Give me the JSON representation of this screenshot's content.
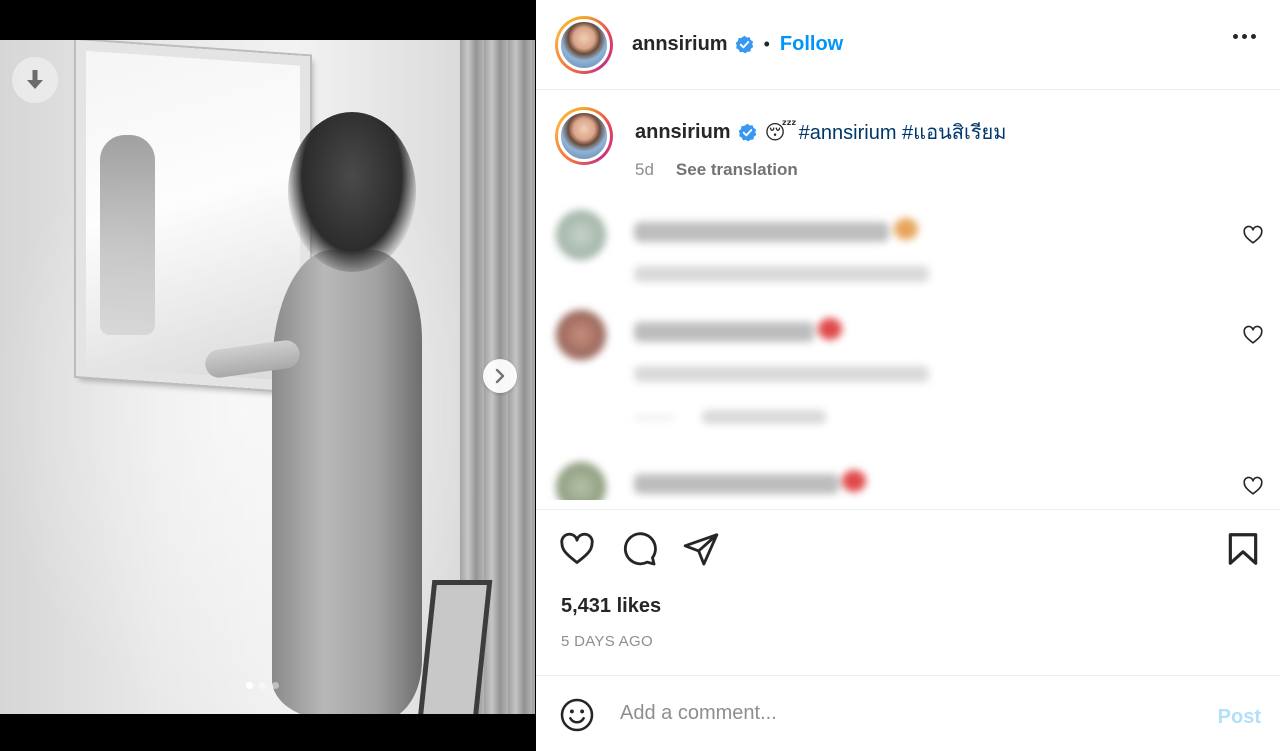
{
  "post": {
    "username": "annsirium",
    "follow_label": "Follow",
    "separator": "•",
    "caption_emoji": "😴",
    "caption_hashtags": "#annsirium #แอนสิเรียม",
    "time_short": "5d",
    "see_translation": "See translation",
    "likes": "5,431 likes",
    "time_ago": "5 DAYS AGO"
  },
  "comment_box": {
    "placeholder": "Add a comment...",
    "post_label": "Post"
  },
  "media": {
    "total_slides": 3,
    "current_slide": 1
  },
  "colors": {
    "accent": "#0095f6",
    "hashtag": "#00376b",
    "muted": "#8e8e8e",
    "post_disabled": "#b2dffc",
    "verified": "#3897f0"
  }
}
